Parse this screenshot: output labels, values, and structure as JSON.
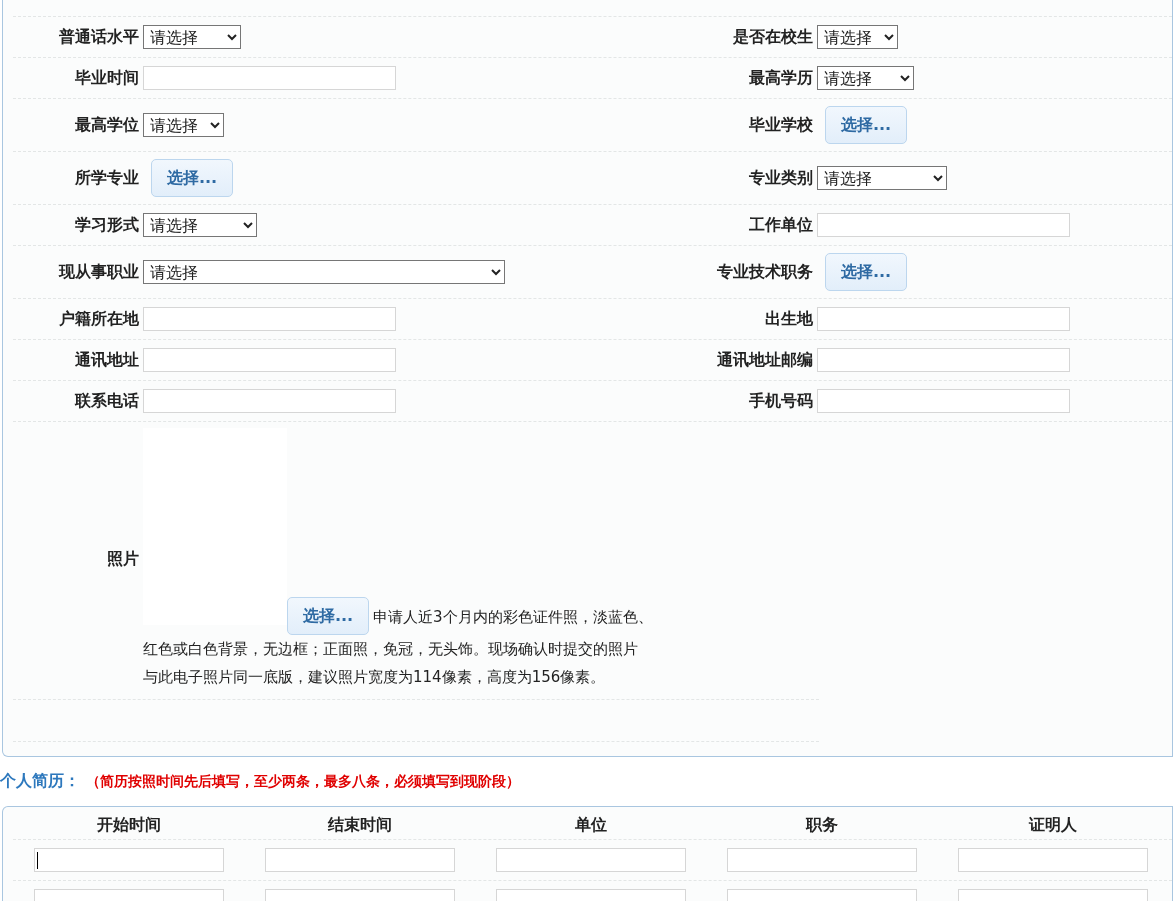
{
  "form": {
    "rows": [
      {
        "cells": [
          {
            "label": "普通话水平",
            "kind": "select",
            "value": "请选择"
          },
          {
            "label": "是否在校生",
            "kind": "select",
            "value": "请选择"
          }
        ]
      },
      {
        "cells": [
          {
            "label": "毕业时间",
            "kind": "text"
          },
          {
            "label": "最高学历",
            "kind": "select",
            "value": "请选择"
          }
        ]
      },
      {
        "cells": [
          {
            "label": "最高学位",
            "kind": "select",
            "value": "请选择"
          },
          {
            "label": "毕业学校",
            "kind": "button",
            "value": "选择..."
          }
        ]
      },
      {
        "cells": [
          {
            "label": "所学专业",
            "kind": "button",
            "value": "选择..."
          },
          {
            "label": "专业类别",
            "kind": "select",
            "value": "请选择"
          }
        ]
      },
      {
        "cells": [
          {
            "label": "学习形式",
            "kind": "select",
            "value": "请选择"
          },
          {
            "label": "工作单位",
            "kind": "text"
          }
        ]
      },
      {
        "cells": [
          {
            "label": "现从事职业",
            "kind": "select",
            "value": "请选择"
          },
          {
            "label": "专业技术职务",
            "kind": "button",
            "value": "选择..."
          }
        ]
      },
      {
        "cells": [
          {
            "label": "户籍所在地",
            "kind": "text"
          },
          {
            "label": "出生地",
            "kind": "text"
          }
        ]
      },
      {
        "cells": [
          {
            "label": "通讯地址",
            "kind": "text"
          },
          {
            "label": "通讯地址邮编",
            "kind": "text"
          }
        ]
      },
      {
        "cells": [
          {
            "label": "联系电话",
            "kind": "text"
          },
          {
            "label": "手机号码",
            "kind": "text"
          }
        ]
      }
    ],
    "photo": {
      "label": "照片",
      "button": "选择...",
      "note_lines": [
        "申请人近3个月内的彩色证件照，淡蓝色、",
        "红色或白色背景，无边框；正面照，免冠，无头饰。现场确认时提交的照片",
        "与此电子照片同一底版，建议照片宽度为114像素，高度为156像素。"
      ]
    }
  },
  "resume": {
    "title": "个人简历：",
    "note": "（简历按照时间先后填写，至少两条，最多八条，必须填写到现阶段）",
    "columns": [
      "开始时间",
      "结束时间",
      "单位",
      "职务",
      "证明人"
    ],
    "rows": [
      {
        "focused": true
      },
      {
        "focused": false
      }
    ]
  }
}
